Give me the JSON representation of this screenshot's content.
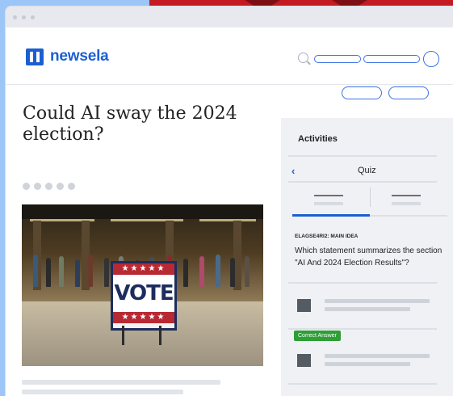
{
  "app": {
    "brand": "newsela"
  },
  "article": {
    "title": "Could AI sway the 2024 election?",
    "image": {
      "sign_stars_top": "★★★★★",
      "sign_text": "VOTE",
      "sign_stars_bottom": "★★★★★"
    }
  },
  "panel": {
    "title": "Activities",
    "quiz": {
      "back_icon": "‹",
      "label": "Quiz",
      "standard": "ELAGSE4RI2: MAIN IDEA",
      "question": "Which statement summarizes the section \"AI And 2024 Election Results\"?",
      "correct_badge": "Correct Answer"
    }
  },
  "colors": {
    "brand_blue": "#1b5fd1",
    "correct_green": "#2e9e35",
    "background_blue": "#9cc6f7",
    "accent_red": "#c41a22"
  },
  "icons": [
    "newsela-logo-icon",
    "search-icon",
    "avatar-icon",
    "back-chevron-icon"
  ]
}
